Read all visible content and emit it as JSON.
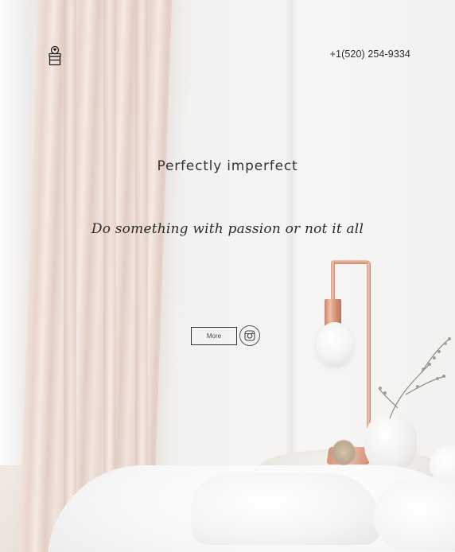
{
  "header": {
    "phone": "+1(520) 254-9334",
    "logo_icon": "fire-hydrant-logo-icon"
  },
  "hero": {
    "title": "Perfectly imperfect",
    "tagline": "Do something with passion or not it all"
  },
  "actions": {
    "more_label": "More",
    "social_icon": "instagram-icon"
  },
  "colors": {
    "text": "#333333",
    "background": "#f4f3f1",
    "accent_copper": "#e0a48c"
  }
}
